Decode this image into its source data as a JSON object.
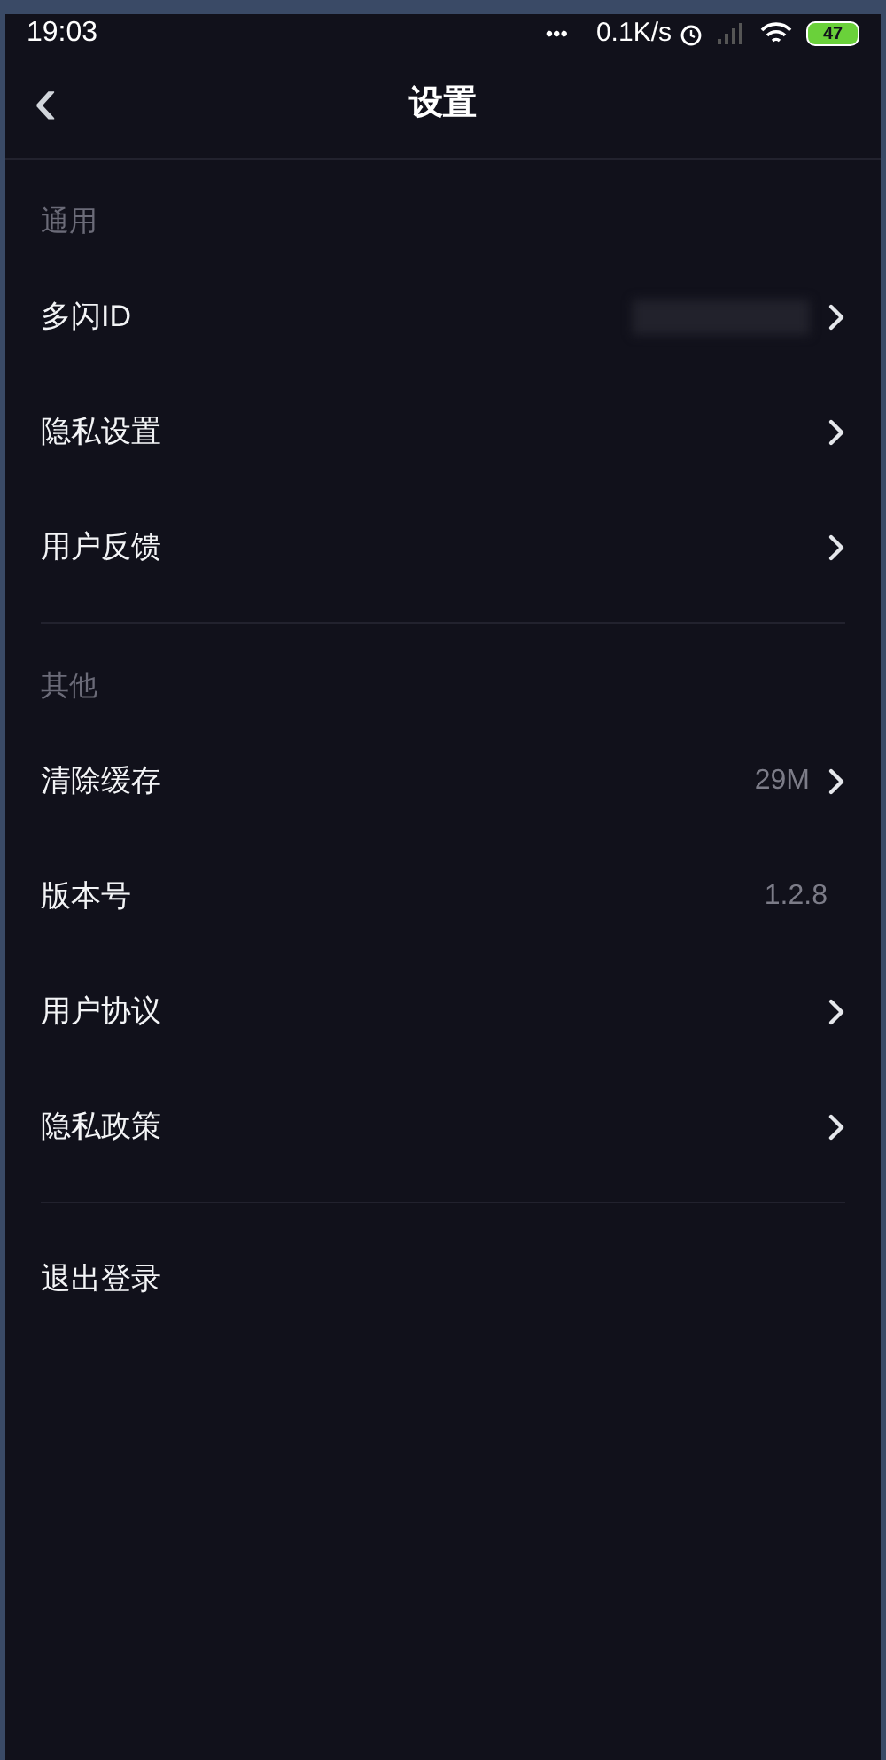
{
  "status_bar": {
    "time": "19:03",
    "dots": "•••",
    "speed": "0.1K/s",
    "battery": "47"
  },
  "header": {
    "back": "‹",
    "title": "设置"
  },
  "sections": [
    {
      "title": "通用",
      "items": [
        {
          "label": "多闪ID",
          "redacted": true,
          "chevron": true
        },
        {
          "label": "隐私设置",
          "redacted": false,
          "chevron": true
        },
        {
          "label": "用户反馈",
          "redacted": false,
          "chevron": true
        }
      ]
    },
    {
      "title": "其他",
      "items": [
        {
          "label": "清除缓存",
          "value": "29M",
          "redacted": false,
          "chevron": true
        },
        {
          "label": "版本号",
          "value": "1.2.8",
          "redacted": false,
          "chevron": false
        },
        {
          "label": "用户协议",
          "redacted": false,
          "chevron": true
        },
        {
          "label": "隐私政策",
          "redacted": false,
          "chevron": true
        }
      ]
    }
  ],
  "logout": "退出登录"
}
